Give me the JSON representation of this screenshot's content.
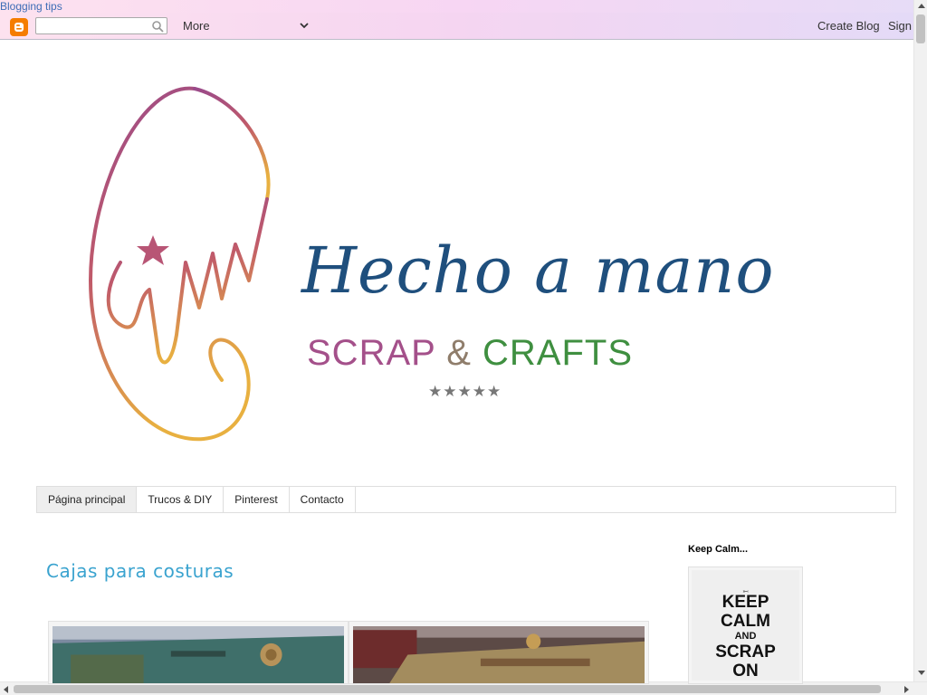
{
  "topbar": {
    "link": "Blogging tips"
  },
  "navbar": {
    "search_placeholder": "",
    "more_label": "More",
    "create_blog": "Create Blog",
    "sign_in": "Sign"
  },
  "header": {
    "title": "Hecho a mano",
    "subtitle_left": "SCRAP",
    "subtitle_amp": "&",
    "subtitle_right": "CRAFTS",
    "stars": "★★★★★"
  },
  "tabs": [
    {
      "label": "Página principal"
    },
    {
      "label": "Trucos & DIY"
    },
    {
      "label": "Pinterest"
    },
    {
      "label": "Contacto"
    }
  ],
  "post": {
    "title": "Cajas para costuras"
  },
  "sidebar": {
    "widget_title": "Keep Calm...",
    "poster": {
      "l1": "KEEP",
      "l2": "CALM",
      "l3": "AND",
      "l4": "SCRAP",
      "l5": "ON"
    }
  },
  "colors": {
    "title_blue": "#1f4f7d",
    "scrap_purple": "#a4508a",
    "crafts_green": "#3f8f40",
    "post_title": "#3aa3cf"
  }
}
